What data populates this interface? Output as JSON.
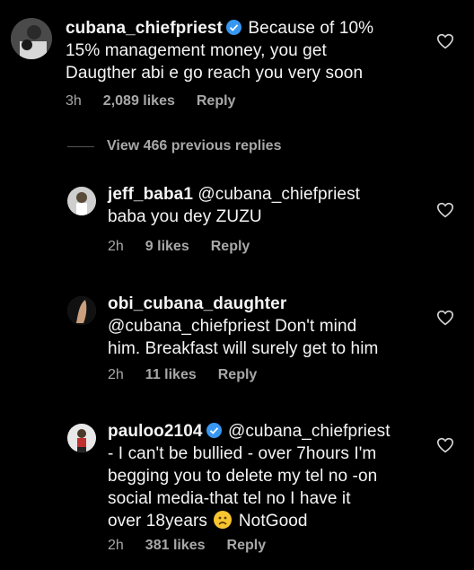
{
  "comments": [
    {
      "username": "cubana_chiefpriest",
      "verified": true,
      "text_line1": "Because of 10%",
      "text_line2": "15% management money, you get",
      "text_line3": "Daugther abi e go reach you very soon",
      "time": "3h",
      "likes": "2,089 likes",
      "reply": "Reply"
    },
    {
      "username": "jeff_baba1",
      "mention": "@cubana_chiefpriest",
      "text_line2": "baba you dey ZUZU",
      "time": "2h",
      "likes": "9 likes",
      "reply": "Reply"
    },
    {
      "username": "obi_cubana_daughter",
      "mention": "@cubana_chiefpriest",
      "text_after_mention": "Don't mind",
      "text_line3": "him. Breakfast will surely get to him",
      "time": "2h",
      "likes": "11 likes",
      "reply": "Reply"
    },
    {
      "username": "pauloo2104",
      "verified": true,
      "mention": "@cubana_chiefpriest",
      "text_line2": "- I can't be bullied - over 7hours I'm",
      "text_line3": "begging you to delete my tel no -on",
      "text_line4": "social media-that tel no I have it",
      "text_line5_a": "over 18years",
      "text_line5_b": "NotGood",
      "time": "2h",
      "likes": "381 likes",
      "reply": "Reply"
    }
  ],
  "view_replies": "View 466 previous replies",
  "icons": {
    "heart": "heart-outline-icon",
    "verified": "verified-badge-icon",
    "emoji": "frowning-face-emoji"
  },
  "colors": {
    "background": "#000000",
    "text": "#f5f5f5",
    "meta": "#a8a8a8",
    "verified": "#3897f0"
  }
}
